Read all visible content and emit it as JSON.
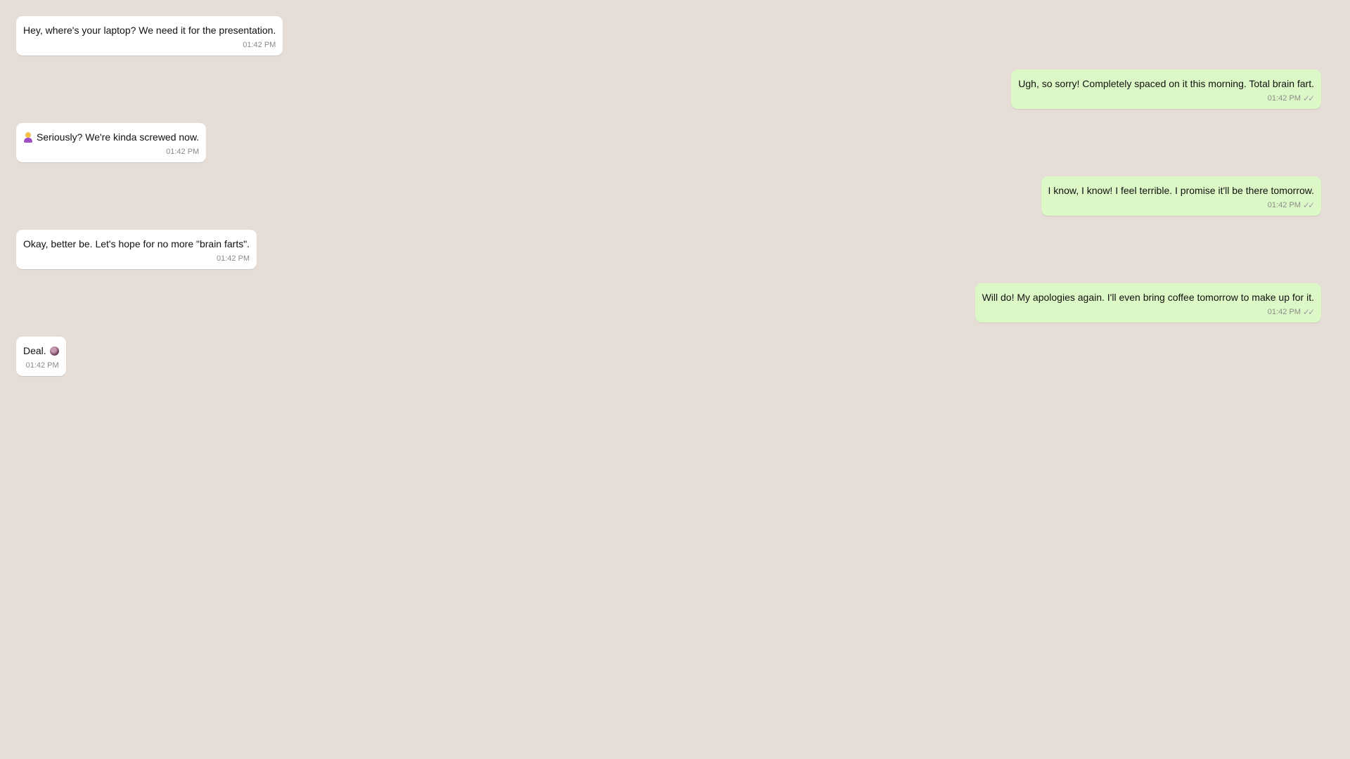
{
  "messages": [
    {
      "direction": "in",
      "text": "Hey, where's your laptop? We need it for the presentation.",
      "time": "01:42 PM"
    },
    {
      "direction": "out",
      "text": "Ugh, so sorry! Completely spaced on it this morning. Total brain fart.",
      "time": "01:42 PM",
      "status": "✓✓"
    },
    {
      "direction": "in",
      "text": "Seriously? We're kinda screwed now.",
      "time": "01:42 PM",
      "emoji": "woman-shrugging-icon"
    },
    {
      "direction": "out",
      "text": "I know, I know! I feel terrible. I promise it'll be there tomorrow.",
      "time": "01:42 PM",
      "status": "✓✓"
    },
    {
      "direction": "in",
      "text": "Okay, better be. Let's hope for no more \"brain farts\".",
      "time": "01:42 PM"
    },
    {
      "direction": "out",
      "text": "Will do! My apologies again. I'll even bring coffee tomorrow to make up for it.",
      "time": "01:42 PM",
      "status": "✓✓"
    },
    {
      "direction": "in",
      "text": "Deal.",
      "time": "01:42 PM",
      "emoji": "reaction-emoji-icon"
    }
  ],
  "colors": {
    "background": "#e5ddd6",
    "incoming_bubble": "#ffffff",
    "outgoing_bubble": "#dcf8c6"
  }
}
